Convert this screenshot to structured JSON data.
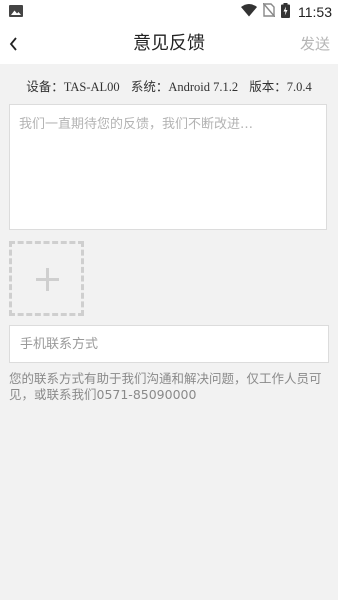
{
  "status_bar": {
    "time": "11:53",
    "icons": [
      "image-icon",
      "wifi-icon",
      "no-sim-icon",
      "battery-charging-icon"
    ]
  },
  "nav": {
    "back_icon": "back-arrow-icon",
    "title": "意见反馈",
    "send_label": "发送"
  },
  "device_info": {
    "device": "设备：TAS-AL00",
    "system": "系统：Android 7.1.2",
    "version": "版本：7.0.4"
  },
  "feedback": {
    "placeholder": "我们一直期待您的反馈，我们不断改进…",
    "value": ""
  },
  "add_image": {
    "icon": "plus-icon"
  },
  "contact": {
    "placeholder": "手机联系方式",
    "value": "",
    "hint": "您的联系方式有助于我们沟通和解决问题，仅工作人员可见，或联系我们0571-85090000"
  },
  "colors": {
    "background": "#f2f2f2",
    "surface": "#ffffff",
    "border": "#dcdcdc",
    "send_disabled": "#b5b5b5",
    "hint_text": "#8a8a8a"
  }
}
